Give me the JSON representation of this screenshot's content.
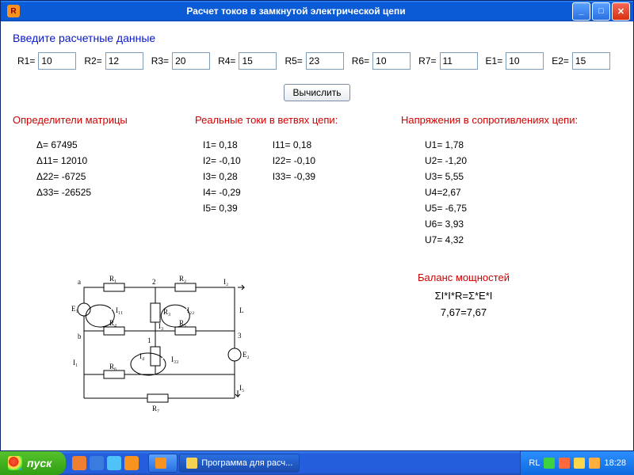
{
  "window": {
    "title": "Расчет токов в замкнутой электрической цепи",
    "icon_letter": "R"
  },
  "form": {
    "header": "Введите  расчетные данные",
    "fields": [
      {
        "label": "R1=",
        "value": "10"
      },
      {
        "label": "R2=",
        "value": "12"
      },
      {
        "label": "R3=",
        "value": "20"
      },
      {
        "label": "R4=",
        "value": "15"
      },
      {
        "label": "R5=",
        "value": "23"
      },
      {
        "label": "R6=",
        "value": "10"
      },
      {
        "label": "R7=",
        "value": "11"
      },
      {
        "label": "E1=",
        "value": "10"
      },
      {
        "label": "E2=",
        "value": "15"
      }
    ],
    "calc_button": "Вычислить"
  },
  "results": {
    "det": {
      "header": "Определители матрицы",
      "rows": [
        "Δ= 67495",
        "Δ11= 12010",
        "Δ22= -6725",
        "Δ33= -26525"
      ]
    },
    "currents": {
      "header": "Реальные токи в ветвях цепи: ",
      "colA": [
        "I1= 0,18",
        "I2= -0,10",
        "I3= 0,28",
        "I4= -0,29",
        "I5= 0,39"
      ],
      "colB": [
        "I11= 0,18",
        "I22= -0,10",
        "I33= -0,39"
      ]
    },
    "volt": {
      "header": "Напряжения в сопротивлениях цепи: ",
      "rows": [
        "U1= 1,78",
        "U2= -1,20",
        "U3= 5,55",
        "U4=2,67",
        "U5= -6,75",
        "U6= 3,93",
        "U7= 4,32"
      ]
    }
  },
  "balance": {
    "header": "Баланс мощностей",
    "formula": "ΣI*I*R=Σ*E*I",
    "equality": "7,67=7,67"
  },
  "circuit": {
    "labels": {
      "R1": "R₁",
      "R2": "R₂",
      "R3": "R₃",
      "R4": "R₄",
      "R5": "R₅",
      "R6": "R₆",
      "R7": "R₇",
      "E1": "E₁",
      "E2": "E₂",
      "L": "L",
      "I1": "I₁",
      "I2": "I₂",
      "I3": "I₃",
      "I4": "I₄",
      "I5": "I₅",
      "I11": "I₁₁",
      "I22": "I₂₂",
      "I33": "I₃₃",
      "n1": "1",
      "n2": "2",
      "n3": "3",
      "a": "a",
      "b": "b"
    }
  },
  "taskbar": {
    "start": "пуск",
    "tasks": [
      {
        "label": "",
        "icon": "#f7931e"
      },
      {
        "label": "Программа для расч...",
        "icon": "#f7d154",
        "active": true
      }
    ],
    "tray": {
      "lang": "RL",
      "time": "18:28"
    }
  }
}
